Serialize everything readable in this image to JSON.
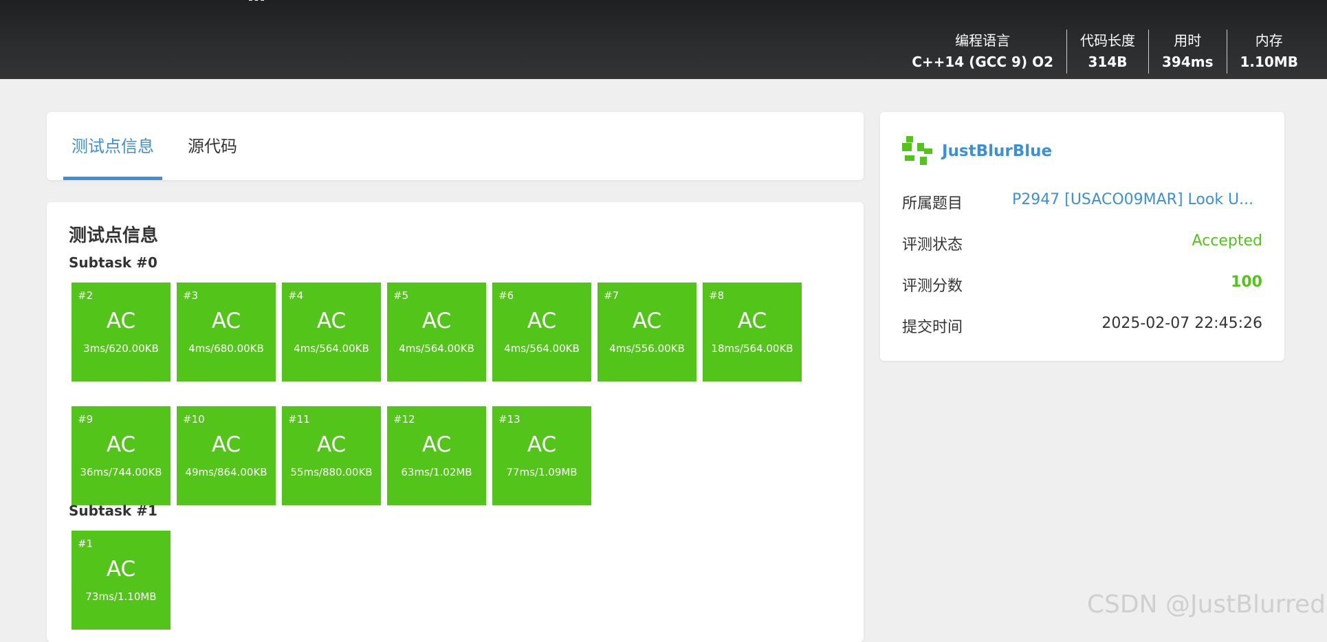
{
  "header": {
    "title_stub": "…",
    "stats": [
      {
        "label": "编程语言",
        "value": "C++14 (GCC 9) O2"
      },
      {
        "label": "代码长度",
        "value": "314B"
      },
      {
        "label": "用时",
        "value": "394ms"
      },
      {
        "label": "内存",
        "value": "1.10MB"
      }
    ]
  },
  "tabs": [
    {
      "label": "测试点信息",
      "active": true
    },
    {
      "label": "源代码",
      "active": false
    }
  ],
  "testcases": {
    "title": "测试点信息",
    "subtasks": [
      {
        "label": "Subtask #0",
        "cases": [
          {
            "id": "#2",
            "status": "AC",
            "meta": "3ms/620.00KB"
          },
          {
            "id": "#3",
            "status": "AC",
            "meta": "4ms/680.00KB"
          },
          {
            "id": "#4",
            "status": "AC",
            "meta": "4ms/564.00KB"
          },
          {
            "id": "#5",
            "status": "AC",
            "meta": "4ms/564.00KB"
          },
          {
            "id": "#6",
            "status": "AC",
            "meta": "4ms/564.00KB"
          },
          {
            "id": "#7",
            "status": "AC",
            "meta": "4ms/556.00KB"
          },
          {
            "id": "#8",
            "status": "AC",
            "meta": "18ms/564.00KB"
          },
          {
            "id": "#9",
            "status": "AC",
            "meta": "36ms/744.00KB"
          },
          {
            "id": "#10",
            "status": "AC",
            "meta": "49ms/864.00KB"
          },
          {
            "id": "#11",
            "status": "AC",
            "meta": "55ms/880.00KB"
          },
          {
            "id": "#12",
            "status": "AC",
            "meta": "63ms/1.02MB"
          },
          {
            "id": "#13",
            "status": "AC",
            "meta": "77ms/1.09MB"
          }
        ]
      },
      {
        "label": "Subtask #1",
        "cases": [
          {
            "id": "#1",
            "status": "AC",
            "meta": "73ms/1.10MB"
          }
        ]
      }
    ]
  },
  "info": {
    "username": "JustBlurBlue",
    "avatar_icon": "identicon-avatar",
    "rows": [
      {
        "key": "所属题目",
        "value": "P2947 [USACO09MAR] Look U..."
      },
      {
        "key": "评测状态",
        "value": "Accepted"
      },
      {
        "key": "评测分数",
        "value": "100"
      },
      {
        "key": "提交时间",
        "value": "2025-02-07 22:45:26"
      }
    ]
  },
  "watermark": "CSDN @JustBlurred",
  "colors": {
    "accent": "#3e8fd4",
    "ac_green": "#52c41a",
    "header_bg": "#2b2c2e",
    "page_bg": "#efefef"
  }
}
